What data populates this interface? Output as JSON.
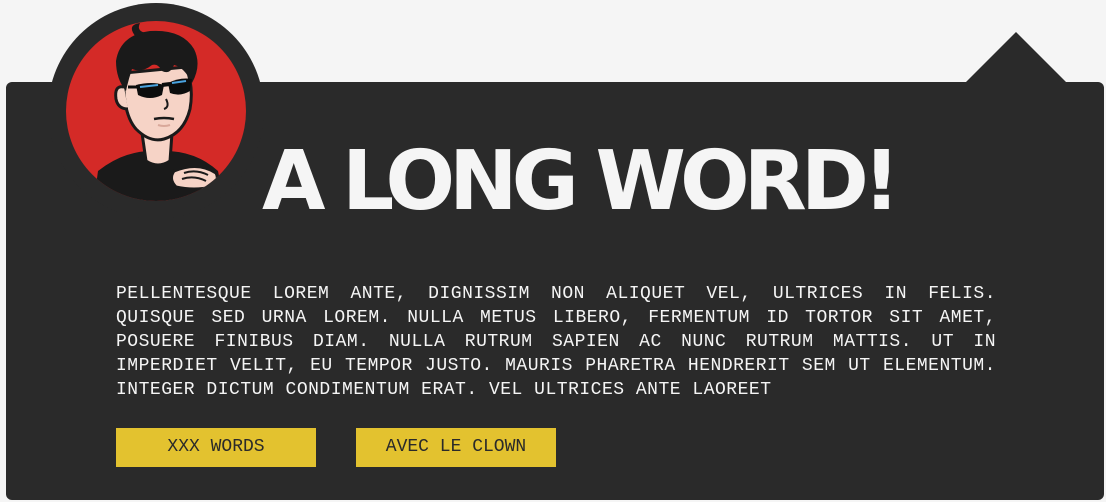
{
  "header": {
    "title": "A LONG WORD!"
  },
  "content": {
    "paragraph": "PELLENTESQUE LOREM ANTE, DIGNISSIM NON ALIQUET VEL, ULTRICES IN FELIS. QUISQUE SED URNA LOREM. NULLA METUS LIBERO, FERMENTUM ID TORTOR SIT AMET, POSUERE FINIBUS DIAM. NULLA RUTRUM SAPIEN AC NUNC RUTRUM MATTIS. UT IN IMPERDIET VELIT, EU TEMPOR JUSTO. MAURIS PHARETRA HENDRERIT SEM UT ELEMENTUM. INTEGER DICTUM CONDIMENTUM ERAT. VEL ULTRICES ANTE LAOREET"
  },
  "buttons": {
    "words_label": "XXX WORDS",
    "clown_label": "AVEC LE CLOWN"
  },
  "avatar": {
    "icon": "cartoon-avatar-sunglasses"
  },
  "colors": {
    "background": "#f5f5f5",
    "card": "#2a2a2a",
    "accent": "#e3c22f",
    "avatar_bg": "#d42a27",
    "text": "#f5f5f5"
  }
}
